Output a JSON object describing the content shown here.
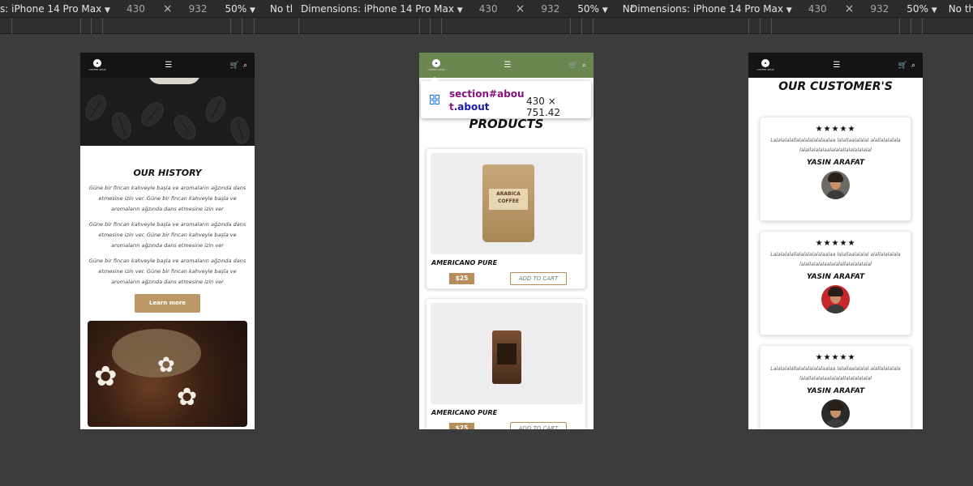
{
  "devtools": {
    "segments": [
      {
        "dimensions": "s: iPhone 14 Pro Max",
        "width": "430",
        "height": "932",
        "zoom": "50%",
        "throttle": "No tl"
      },
      {
        "dimensions": "Dimensions: iPhone 14 Pro Max",
        "width": "430",
        "height": "932",
        "zoom": "50%",
        "throttle": "Nc"
      },
      {
        "dimensions": "Dimensions: iPhone 14 Pro Max",
        "width": "430",
        "height": "932",
        "zoom": "50%",
        "throttle": "No throttling"
      }
    ],
    "times_sign": "×",
    "caret": "▼"
  },
  "nav": {
    "logo_text": "COFFEE SHOP",
    "menu_icon": "menu-icon",
    "cart_icon": "cart-icon",
    "search_icon": "search-icon"
  },
  "history": {
    "title": "OUR HISTORY",
    "paragraphs": [
      "Güne bir fincan kahveyle başla ve aromaların ağzında dans etmesine izin ver. Güne bir fincan kahveyle başla ve aromaların ağzında dans etmesine izin ver",
      "Güne bir fincan kahveyle başla ve aromaların ağzında dans etmesine izin ver. Güne bir fincan kahveyle başla ve aromaların ağzında dans etmesine izin ver",
      "Güne bir fincan kahveyle başla ve aromaların ağzında dans etmesine izin ver. Güne bir fincan kahveyle başla ve aromaların ağzında dans etmesine izin ver"
    ],
    "button": "Learn more"
  },
  "products": {
    "title": "PRODUCTS",
    "items": [
      {
        "name": "AMERICANO PURE",
        "price": "$25",
        "cart": "ADD TO CART",
        "bag_label": "ARABICA COFFEE"
      },
      {
        "name": "AMERICANO PURE",
        "price": "$25",
        "cart": "ADD TO CART",
        "bag_label": ""
      }
    ]
  },
  "inspector": {
    "selector_tag": "section",
    "selector_id": "#abou",
    "selector_rest": "t",
    "selector_class": ".about",
    "size": "430 × 751.42"
  },
  "customers": {
    "title": "OUR CUSTOMER'S",
    "reviews": [
      {
        "stars": "★★★★★",
        "rating": 4.5,
        "text": "Lalalalalallalalalalalalaalaa lalallaalalalal alallalalalala lalallalalalaalalalallalalalalalal",
        "name": "YASIN ARAFAT"
      },
      {
        "stars": "★★★★★",
        "rating": 4.5,
        "text": "Lalalalalallalalalalalalaalaa lalallaalalalal alallalalalala lalallalalalaalalalallalalalalalal",
        "name": "YASIN ARAFAT"
      },
      {
        "stars": "★★★★★",
        "rating": 4.5,
        "text": "Lalalalalallalalalalalalaalaa lalallaalalalal alallalalalala lalallalalalaalalalallalalalalalal",
        "name": "YASIN ARAFAT"
      }
    ]
  },
  "colors": {
    "background": "#3c3c3c",
    "accent": "#bb9866",
    "nav_green": "#6a8750",
    "nav_dark": "#141414"
  }
}
